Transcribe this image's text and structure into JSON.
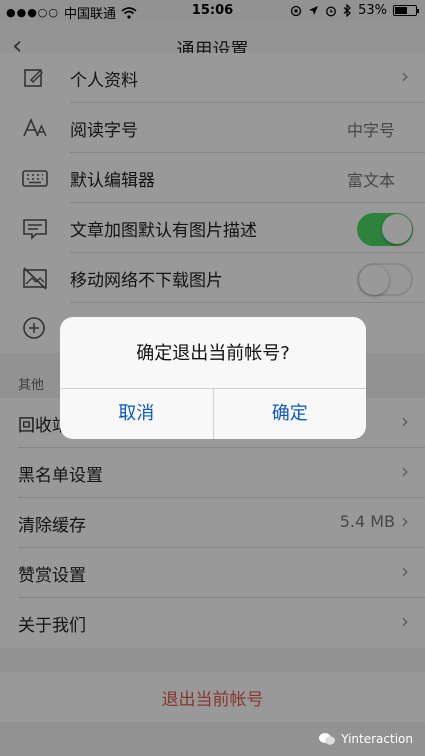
{
  "status_bar": {
    "signal": "●●●○○",
    "carrier": "中国联通",
    "time": "15:06",
    "battery": "53%"
  },
  "nav": {
    "back": "‹",
    "title": "通用设置"
  },
  "rows": [
    {
      "label": "个人资料",
      "icon": "profile-edit-icon"
    },
    {
      "label": "阅读字号",
      "value": "中字号",
      "icon": "font-size-icon"
    },
    {
      "label": "默认编辑器",
      "value": "富文本",
      "icon": "keyboard-icon"
    },
    {
      "label": "文章加图默认有图片描述",
      "toggle": true,
      "icon": "caption-icon"
    },
    {
      "label": "移动网络不下载图片",
      "toggle": false,
      "icon": "no-image-icon"
    },
    {
      "icon": "add-circle-icon"
    }
  ],
  "section_other": {
    "header": "其他",
    "items": [
      {
        "label": "回收站"
      },
      {
        "label": "黑名单设置"
      },
      {
        "label": "清除缓存",
        "value": "5.4 MB"
      },
      {
        "label": "赞赏设置"
      },
      {
        "label": "关于我们"
      }
    ]
  },
  "logout": {
    "label": "退出当前帐号"
  },
  "dialog": {
    "message": "确定退出当前帐号?",
    "cancel": "取消",
    "confirm": "确定"
  },
  "watermark": {
    "text": "Yinteraction"
  },
  "colors": {
    "toggle_on": "#4cd964",
    "dialog_button": "#0b57c6",
    "logout": "#e05a4a"
  }
}
